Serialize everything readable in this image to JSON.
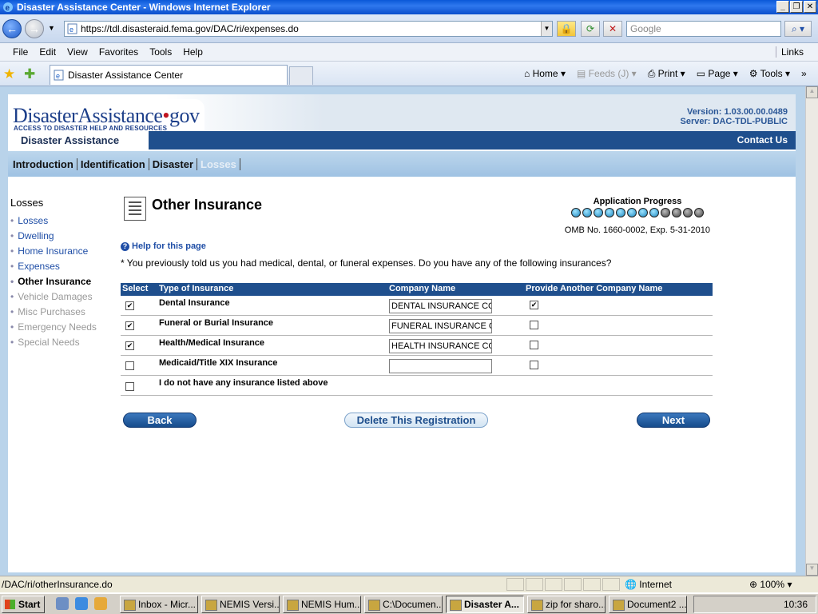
{
  "window": {
    "title": "Disaster Assistance Center - Windows Internet Explorer"
  },
  "browser": {
    "url": "https://tdl.disasteraid.fema.gov/DAC/ri/expenses.do",
    "search_placeholder": "Google",
    "menu": [
      "File",
      "Edit",
      "View",
      "Favorites",
      "Tools",
      "Help"
    ],
    "links_label": "Links",
    "tab_title": "Disaster Assistance Center",
    "commands": {
      "home": "Home",
      "feeds": "Feeds (J)",
      "print": "Print",
      "page": "Page",
      "tools": "Tools"
    }
  },
  "site": {
    "logo_main": "DisasterAssistance",
    "logo_dot": "•",
    "logo_gov": "gov",
    "logo_tagline": "ACCESS TO DISASTER HELP AND RESOURCES",
    "version": "Version: 1.03.00.00.0489",
    "server": "Server: DAC-TDL-PUBLIC",
    "section_title": "Disaster Assistance",
    "contact": "Contact Us",
    "steps": [
      {
        "label": "Introduction"
      },
      {
        "label": "Identification"
      },
      {
        "label": "Disaster"
      },
      {
        "label": "Losses"
      }
    ]
  },
  "sidebar": {
    "heading": "Losses",
    "items": [
      {
        "label": "Losses"
      },
      {
        "label": "Dwelling"
      },
      {
        "label": "Home Insurance"
      },
      {
        "label": "Expenses"
      },
      {
        "label": "Other Insurance"
      },
      {
        "label": "Vehicle Damages"
      },
      {
        "label": "Misc Purchases"
      },
      {
        "label": "Emergency Needs"
      },
      {
        "label": "Special Needs"
      }
    ]
  },
  "main": {
    "title": "Other Insurance",
    "progress_label": "Application Progress",
    "progress": {
      "completed": 8,
      "total": 12
    },
    "omb": "OMB No. 1660-0002, Exp. 5-31-2010",
    "help": "Help for this page",
    "intro": "* You previously told us you had medical, dental, or funeral expenses. Do you have any of the following insurances?",
    "table": {
      "headers": {
        "select": "Select",
        "type": "Type of Insurance",
        "company": "Company Name",
        "another": "Provide Another Company Name"
      },
      "rows": [
        {
          "type": "Dental Insurance",
          "company": "DENTAL INSURANCE CO",
          "selected": true,
          "another": true
        },
        {
          "type": "Funeral or Burial Insurance",
          "company": "FUNERAL INSURANCE CO",
          "selected": true,
          "another": false
        },
        {
          "type": "Health/Medical Insurance",
          "company": "HEALTH INSURANCE CO",
          "selected": true,
          "another": false
        },
        {
          "type": "Medicaid/Title XIX Insurance",
          "company": "",
          "selected": false,
          "another": false
        },
        {
          "type": "I do not have any insurance listed above",
          "selected": false
        }
      ]
    },
    "buttons": {
      "back": "Back",
      "delete": "Delete This Registration",
      "next": "Next"
    }
  },
  "status": {
    "url": "/DAC/ri/otherInsurance.do",
    "zone": "Internet",
    "zoom": "100%"
  },
  "taskbar": {
    "start": "Start",
    "items": [
      {
        "label": "Inbox - Micr..."
      },
      {
        "label": "NEMIS Versi..."
      },
      {
        "label": "NEMIS Hum..."
      },
      {
        "label": "C:\\Documen..."
      },
      {
        "label": "Disaster A..."
      },
      {
        "label": "zip for sharo..."
      },
      {
        "label": "Document2 ..."
      }
    ],
    "clock": "10:36"
  }
}
